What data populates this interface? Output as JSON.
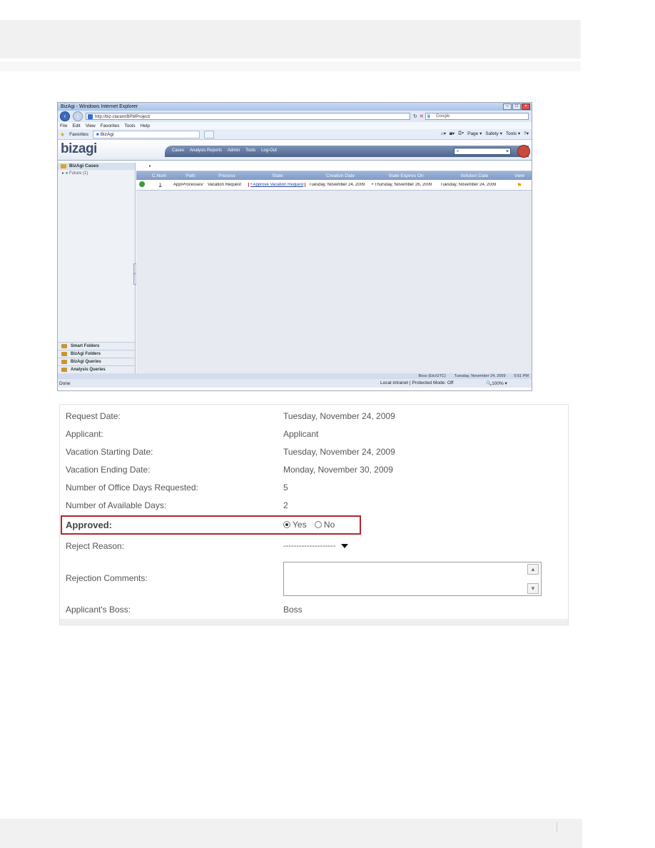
{
  "browser": {
    "title": "BizAgi - Windows Internet Explorer",
    "address": "http://biz-claram/BPMProject/",
    "search_placeholder": "Google",
    "menu": [
      "File",
      "Edit",
      "View",
      "Favorites",
      "Tools",
      "Help"
    ],
    "favorites_label": "Favorites",
    "tab_label": "BizAgi",
    "command_bar": [
      "Page ▾",
      "Safety ▾",
      "Tools ▾"
    ],
    "status_left": "Done",
    "status_zone": "Local intranet | Protected Mode: Off",
    "status_zoom": "100%"
  },
  "bizagi": {
    "logo": "bizagi",
    "menu": [
      "Cases",
      "Analysis Reports",
      "Admin",
      "Tools",
      "Log-Out"
    ],
    "sidebar": {
      "header": "BizAgi Cases",
      "sub": "Future (1)",
      "footer": [
        "Smart Folders",
        "BizAgi Folders",
        "BizAgi Queries",
        "Analysis Queries"
      ]
    },
    "table": {
      "headers": [
        "C.Num",
        "Path",
        "Process",
        "State",
        "Creation Date",
        "State Expires On",
        "Solution Date",
        "View"
      ],
      "row": {
        "num": "1",
        "path": "App/Processes/",
        "process": "Vacation Request",
        "state": "• Approve Vacation Request",
        "creation": "Tuesday, November 24, 2009",
        "expires": "• Thursday, November 26, 2009",
        "solution": "Tuesday, November 24, 2009"
      }
    },
    "statusbar": {
      "user": "Boss (Etc/UTC)",
      "date": "Tuesday, November 24, 2009",
      "time": "5:51 PM"
    }
  },
  "form": {
    "request_date_label": "Request Date:",
    "request_date_value": "Tuesday, November 24, 2009",
    "applicant_label": "Applicant:",
    "applicant_value": "Applicant",
    "vac_start_label": "Vacation Starting Date:",
    "vac_start_value": "Tuesday, November 24, 2009",
    "vac_end_label": "Vacation Ending Date:",
    "vac_end_value": "Monday, November 30, 2009",
    "office_days_label": "Number of Office Days Requested:",
    "office_days_value": "5",
    "available_days_label": "Number of Available Days:",
    "available_days_value": "2",
    "approved_label": "Approved:",
    "approved_yes": "Yes",
    "approved_no": "No",
    "reject_reason_label": "Reject Reason:",
    "reject_reason_value": "--------------------",
    "rejection_comments_label": "Rejection Comments:",
    "boss_label": "Applicant's Boss:",
    "boss_value": "Boss"
  }
}
